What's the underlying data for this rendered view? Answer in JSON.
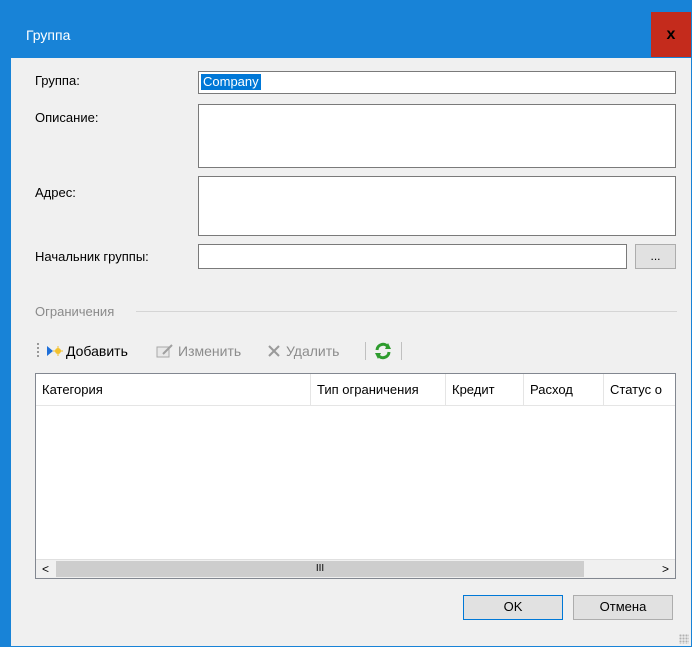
{
  "window": {
    "title": "Группа",
    "close_label": "x"
  },
  "form": {
    "group_label": "Группа:",
    "group_value": "Company",
    "description_label": "Описание:",
    "address_label": "Адрес:",
    "manager_label": "Начальник группы:",
    "browse_label": "..."
  },
  "restrictions": {
    "section_label": "Ограничения",
    "toolbar": {
      "add_label": "Добавить",
      "edit_label": "Изменить",
      "delete_label": "Удалить"
    },
    "columns": [
      "Категория",
      "Тип ограничения",
      "Кредит",
      "Расход",
      "Статус о"
    ],
    "rows": [],
    "scroll_left": "<",
    "scroll_right": ">",
    "scroll_thumb": "III"
  },
  "buttons": {
    "ok_label": "OK",
    "cancel_label": "Отмена"
  },
  "colors": {
    "title_bar": "#1883d7",
    "close": "#c42b1c",
    "selection": "#0078d7"
  }
}
